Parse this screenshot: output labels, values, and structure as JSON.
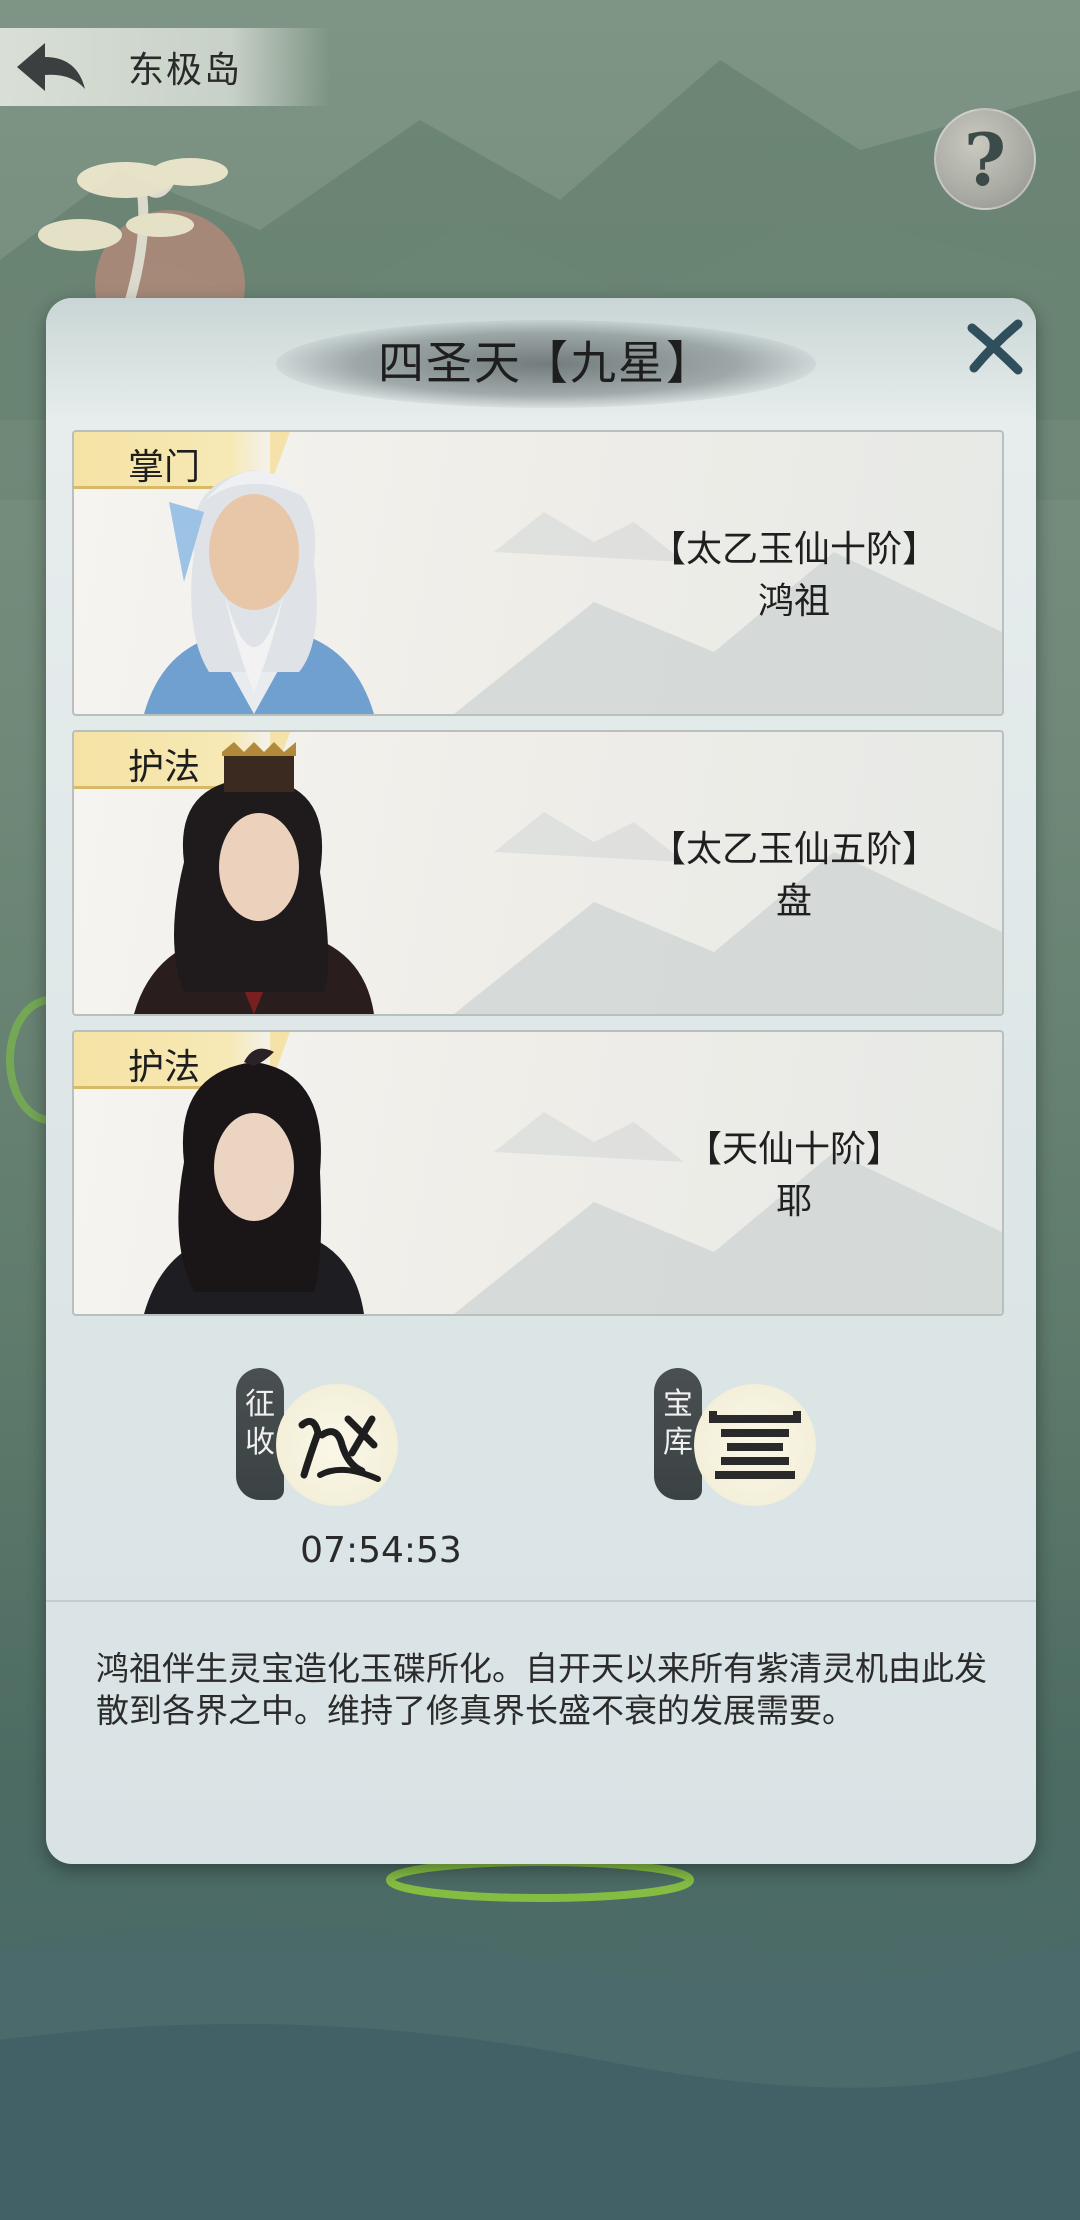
{
  "topbar": {
    "location": "东极岛"
  },
  "help": {
    "label": "?"
  },
  "dialog": {
    "title": "四圣天【九星】",
    "members": [
      {
        "rank": "掌门",
        "realm": "【太乙玉仙十阶】",
        "name": "鸿祖"
      },
      {
        "rank": "护法",
        "realm": "【太乙玉仙五阶】",
        "name": "盘"
      },
      {
        "rank": "护法",
        "realm": "【天仙十阶】",
        "name": "耶"
      }
    ],
    "actions": {
      "levy": {
        "tag_top": "征",
        "tag_bottom": "收",
        "timer": "07:54:53"
      },
      "vault": {
        "tag_top": "宝",
        "tag_bottom": "库"
      }
    },
    "description": "鸿祖伴生灵宝造化玉碟所化。自开天以来所有紫清灵机由此发散到各界之中。维持了修真界长盛不衰的发展需要。"
  },
  "colors": {
    "rank_tag": "#f4e3a4",
    "dialog_bg": "#e3eaea",
    "ink": "#1e1e1e"
  }
}
